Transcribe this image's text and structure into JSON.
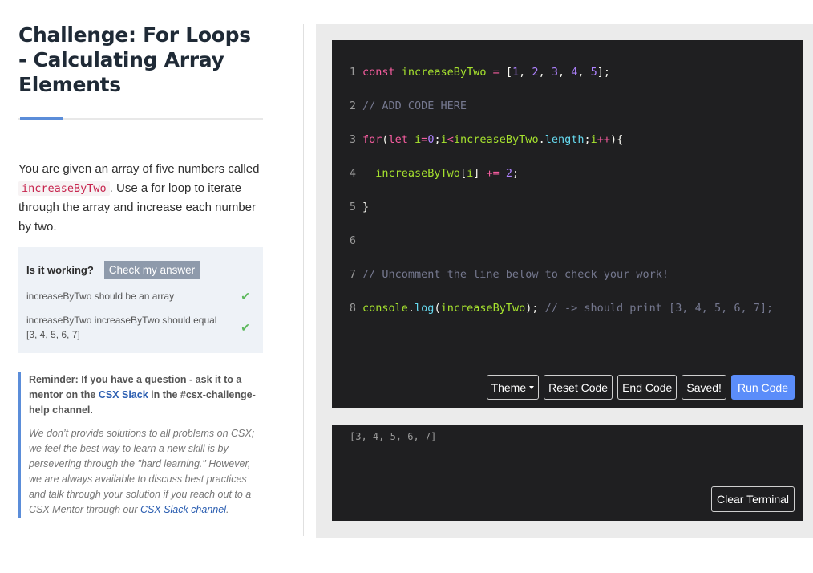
{
  "challenge": {
    "title": "Challenge: For Loops - Calculating Array Elements",
    "description": {
      "before": "You are given an array of five numbers called ",
      "code": "increaseByTwo",
      "after": ". Use a for loop to iterate through the array and increase each number by two."
    }
  },
  "checker": {
    "question": "Is it working?",
    "button_label": "Check my answer",
    "items": [
      {
        "text": "increaseByTwo should be an array",
        "status": "pass"
      },
      {
        "text": "increaseByTwo increaseByTwo should equal [3, 4, 5, 6, 7]",
        "status": "pass"
      }
    ]
  },
  "reminder": {
    "strong_before": "Reminder: If you have a question - ask it to a mentor on the ",
    "strong_link": "CSX Slack",
    "strong_after": " in the #csx-challenge-help channel.",
    "em_before": "We don’t provide solutions to all problems on CSX; we feel the best way to learn a new skill is by persevering through the \"hard learning.\" However, we are always available to discuss best practices and talk through your solution if you reach out to a CSX Mentor through our ",
    "em_link": "CSX Slack channel",
    "em_after": "."
  },
  "editor": {
    "line_numbers": [
      "1",
      "2",
      "3",
      "4",
      "5",
      "6",
      "7",
      "8"
    ],
    "lines": [
      "const increaseByTwo = [1, 2, 3, 4, 5];",
      "// ADD CODE HERE",
      "for(let i=0;i<increaseByTwo.length;i++){",
      "  increaseByTwo[i] += 2;",
      "}",
      "",
      "// Uncomment the line below to check your work!",
      "console.log(increaseByTwo); // -> should print [3, 4, 5, 6, 7];"
    ],
    "buttons": {
      "theme": "Theme",
      "reset": "Reset Code",
      "end": "End Code",
      "saved": "Saved!",
      "run": "Run Code"
    }
  },
  "terminal": {
    "output": "[3, 4, 5, 6, 7]",
    "clear_label": "Clear Terminal"
  },
  "colors": {
    "accent": "#5b8dd9",
    "run_button": "#5b8dfa",
    "pass": "#5cb85c",
    "editor_bg": "#1f1f21"
  }
}
